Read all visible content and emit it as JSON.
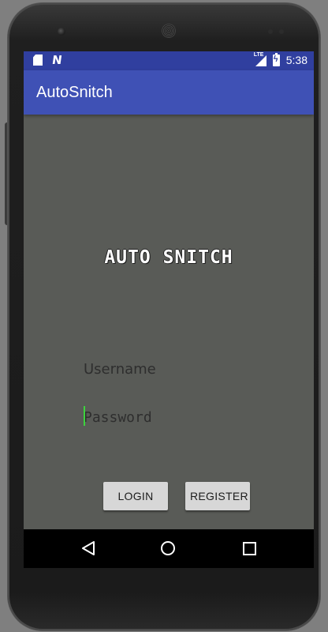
{
  "status_bar": {
    "left_icons": [
      "sd-card-icon",
      "n-notification-icon"
    ],
    "network": "LTE",
    "time": "5:38"
  },
  "app_bar": {
    "title": "AutoSnitch"
  },
  "main": {
    "logo_text": "AUTO SNITCH",
    "username_placeholder": "Username",
    "password_placeholder": "Password",
    "login_label": "LOGIN",
    "register_label": "REGISTER"
  },
  "nav_bar": {
    "icons": [
      "back-icon",
      "home-icon",
      "recents-icon"
    ]
  },
  "colors": {
    "status_bar": "#303f9f",
    "app_bar": "#3f51b5",
    "screen_bg": "#595b57",
    "button_bg": "#d7d7d7",
    "cursor": "#3dd33d"
  }
}
